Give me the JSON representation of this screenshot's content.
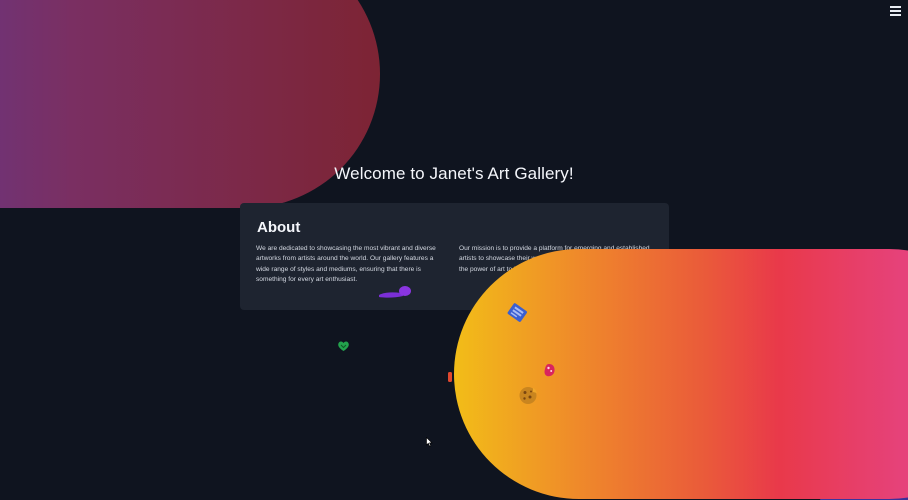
{
  "header": {
    "menu_icon": "hamburger-menu-icon"
  },
  "hero": {
    "title": "Welcome to Janet's Art Gallery!"
  },
  "about": {
    "heading": "About",
    "paragraph_1": "We are dedicated to showcasing the most vibrant and diverse artworks from artists around the world. Our gallery features a wide range of styles and mediums, ensuring that there is something for every art enthusiast.",
    "paragraph_2": "Our mission is to provide a platform for emerging and established artists to showcase their work to a wider audience. We believe in the power of art to inspire, connect, and bring people together."
  },
  "decorations": {
    "icons": [
      "paintbrush-icon",
      "heart-icon",
      "paint-tube-icon",
      "book-icon",
      "palette-icon",
      "cookie-icon",
      "cursor-icon"
    ],
    "colors": {
      "background": "#0f141f",
      "card": "#1e2430",
      "blob_top_start": "#5c3a9a",
      "blob_top_end": "#7d2434",
      "blob_bottom_start": "#f2bd18",
      "blob_bottom_mid": "#e9394a",
      "blob_bottom_end": "#e24a8e"
    }
  }
}
